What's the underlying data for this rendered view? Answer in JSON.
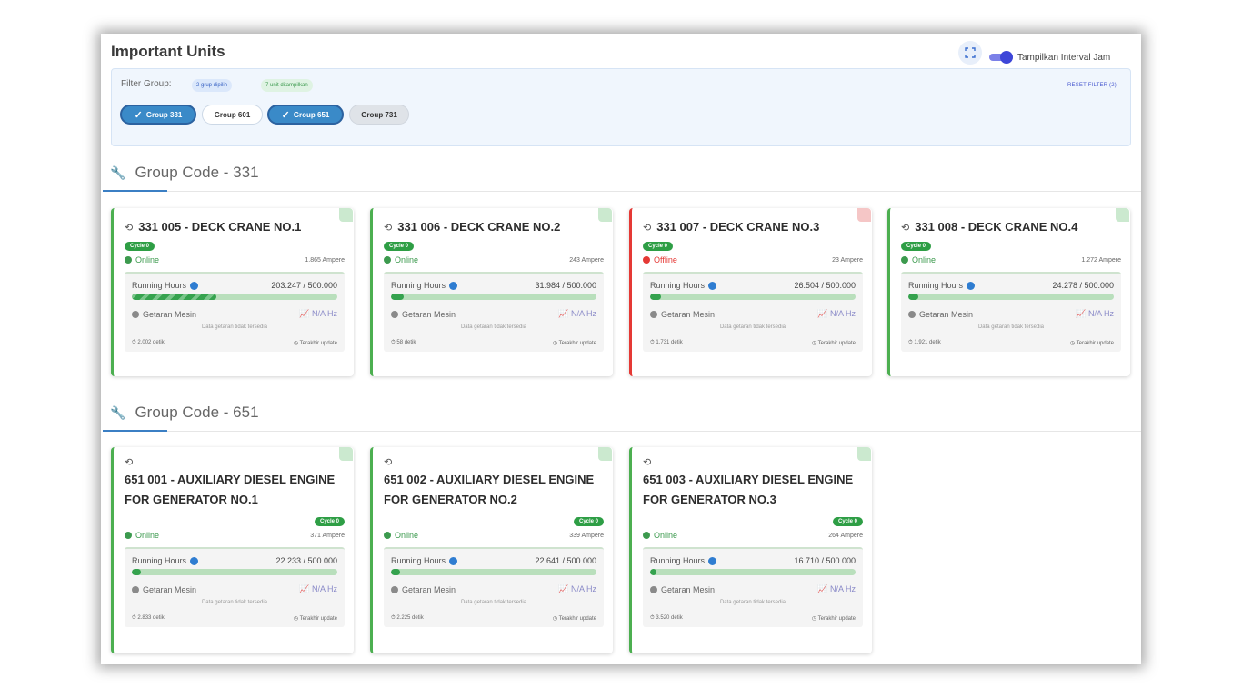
{
  "header": {
    "title": "Important Units",
    "toggle_label": "Tampilkan Interval Jam"
  },
  "filter": {
    "label": "Filter Group:",
    "groups_selected": "2 grup dipilih",
    "units_shown": "7 unit ditampilkan",
    "reset": "RESET FILTER (2)",
    "chips": [
      {
        "label": "Group 331",
        "selected": true
      },
      {
        "label": "Group 601",
        "selected": false
      },
      {
        "label": "Group 651",
        "selected": true
      },
      {
        "label": "Group 731",
        "selected": false
      }
    ]
  },
  "groups": [
    {
      "title": "Group Code - 331",
      "units": [
        {
          "name": "331 005 - DECK CRANE NO.1",
          "cycle": "Cycle 0",
          "status": "Online",
          "current": "1.865 Ampere",
          "rh_label": "Running Hours",
          "rh_value": "203.247 / 500.000",
          "rh_progress": 0.41,
          "vib_label": "Getaran Mesin",
          "vib_value": "N/A Hz",
          "vib_note": "Data getaran tidak tersedia",
          "seconds": "2.002 detik",
          "last_update": "Terakhir update"
        },
        {
          "name": "331 006 - DECK CRANE NO.2",
          "cycle": "Cycle 0",
          "status": "Online",
          "current": "243 Ampere",
          "rh_label": "Running Hours",
          "rh_value": "31.984 / 500.000",
          "rh_progress": 0.064,
          "vib_label": "Getaran Mesin",
          "vib_value": "N/A Hz",
          "vib_note": "Data getaran tidak tersedia",
          "seconds": "58 detik",
          "last_update": "Terakhir update"
        },
        {
          "name": "331 007 - DECK CRANE NO.3",
          "cycle": "Cycle 0",
          "status": "Offline",
          "current": "23 Ampere",
          "rh_label": "Running Hours",
          "rh_value": "26.504 / 500.000",
          "rh_progress": 0.053,
          "vib_label": "Getaran Mesin",
          "vib_value": "N/A Hz",
          "vib_note": "Data getaran tidak tersedia",
          "seconds": "1.731 detik",
          "last_update": "Terakhir update"
        },
        {
          "name": "331 008 - DECK CRANE NO.4",
          "cycle": "Cycle 0",
          "status": "Online",
          "current": "1.272 Ampere",
          "rh_label": "Running Hours",
          "rh_value": "24.278 / 500.000",
          "rh_progress": 0.049,
          "vib_label": "Getaran Mesin",
          "vib_value": "N/A Hz",
          "vib_note": "Data getaran tidak tersedia",
          "seconds": "1.921 detik",
          "last_update": "Terakhir update"
        }
      ]
    },
    {
      "title": "Group Code - 651",
      "units": [
        {
          "name": "651 001 - AUXILIARY DIESEL ENGINE FOR GENERATOR NO.1",
          "cycle": "Cycle 0",
          "status": "Online",
          "current": "371 Ampere",
          "rh_label": "Running Hours",
          "rh_value": "22.233 / 500.000",
          "rh_progress": 0.044,
          "vib_label": "Getaran Mesin",
          "vib_value": "N/A Hz",
          "vib_note": "Data getaran tidak tersedia",
          "seconds": "2.833 detik",
          "last_update": "Terakhir update"
        },
        {
          "name": "651 002 - AUXILIARY DIESEL ENGINE FOR GENERATOR NO.2",
          "cycle": "Cycle 0",
          "status": "Online",
          "current": "339 Ampere",
          "rh_label": "Running Hours",
          "rh_value": "22.641 / 500.000",
          "rh_progress": 0.045,
          "vib_label": "Getaran Mesin",
          "vib_value": "N/A Hz",
          "vib_note": "Data getaran tidak tersedia",
          "seconds": "2.225 detik",
          "last_update": "Terakhir update"
        },
        {
          "name": "651 003 - AUXILIARY DIESEL ENGINE FOR GENERATOR NO.3",
          "cycle": "Cycle 0",
          "status": "Online",
          "current": "264 Ampere",
          "rh_label": "Running Hours",
          "rh_value": "16.710 / 500.000",
          "rh_progress": 0.033,
          "vib_label": "Getaran Mesin",
          "vib_value": "N/A Hz",
          "vib_note": "Data getaran tidak tersedia",
          "seconds": "3.520 detik",
          "last_update": "Terakhir update"
        }
      ]
    }
  ],
  "colors": {
    "online": "#3c9a4e",
    "offline": "#e53935",
    "accent": "#3b7fc4",
    "chip_selected": "#3a8ac8"
  },
  "icons": {
    "group": "wrench-icon",
    "history": "history-icon",
    "fullscreen": "fullscreen-icon",
    "vibration": "chart-icon",
    "timer": "timer-icon",
    "clock": "clock-icon"
  }
}
